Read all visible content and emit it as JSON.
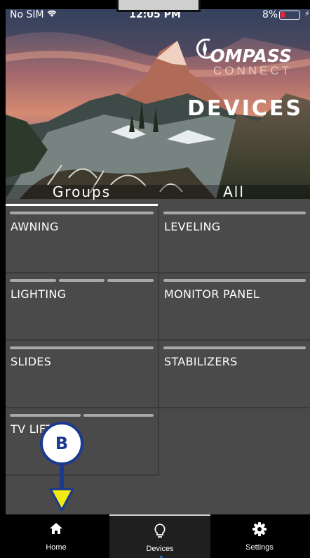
{
  "status_bar": {
    "carrier": "No SIM",
    "time": "12:05 PM",
    "battery": "8%"
  },
  "brand": {
    "line1": "OMPASS",
    "line2": "CONNECT"
  },
  "page_title": "DEVICES",
  "tabs": {
    "groups": "Groups",
    "all": "All"
  },
  "tiles": [
    {
      "label": "AWNING",
      "bars": 1
    },
    {
      "label": "LEVELING",
      "bars": 1
    },
    {
      "label": "LIGHTING",
      "bars": 3
    },
    {
      "label": "MONITOR PANEL",
      "bars": 1
    },
    {
      "label": "SLIDES",
      "bars": 1
    },
    {
      "label": "STABILIZERS",
      "bars": 1
    },
    {
      "label": "TV LIFTS",
      "bars": 2
    }
  ],
  "marker": {
    "letter": "B"
  },
  "bottom_nav": {
    "home": "Home",
    "devices": "Devices",
    "settings": "Settings"
  },
  "colors": {
    "marker_blue": "#1b3a8f",
    "arrow_yellow": "#f2ea12",
    "battery_low": "#e8253a",
    "tile_bg": "#4a4a4a"
  }
}
